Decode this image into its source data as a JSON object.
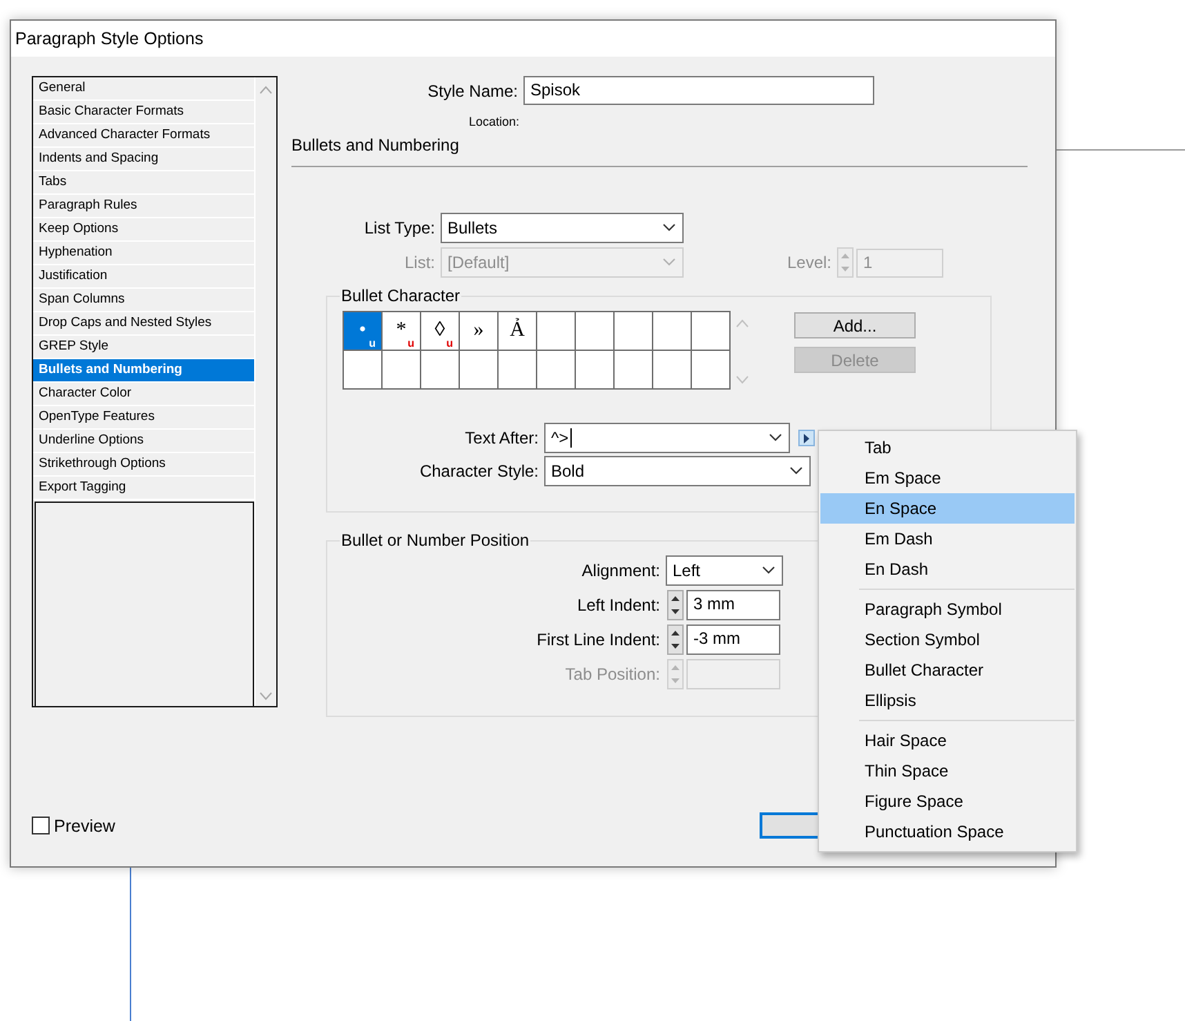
{
  "window": {
    "title": "Paragraph Style Options"
  },
  "sidebar": {
    "items": [
      {
        "label": "General",
        "selected": false
      },
      {
        "label": "Basic Character Formats",
        "selected": false
      },
      {
        "label": "Advanced Character Formats",
        "selected": false
      },
      {
        "label": "Indents and Spacing",
        "selected": false
      },
      {
        "label": "Tabs",
        "selected": false
      },
      {
        "label": "Paragraph Rules",
        "selected": false
      },
      {
        "label": "Keep Options",
        "selected": false
      },
      {
        "label": "Hyphenation",
        "selected": false
      },
      {
        "label": "Justification",
        "selected": false
      },
      {
        "label": "Span Columns",
        "selected": false
      },
      {
        "label": "Drop Caps and Nested Styles",
        "selected": false
      },
      {
        "label": "GREP Style",
        "selected": false
      },
      {
        "label": "Bullets and Numbering",
        "selected": true
      },
      {
        "label": "Character Color",
        "selected": false
      },
      {
        "label": "OpenType Features",
        "selected": false
      },
      {
        "label": "Underline Options",
        "selected": false
      },
      {
        "label": "Strikethrough Options",
        "selected": false
      },
      {
        "label": "Export Tagging",
        "selected": false
      }
    ]
  },
  "style_name": {
    "label": "Style Name:",
    "value": "Spisok"
  },
  "location": {
    "label": "Location:"
  },
  "section_title": "Bullets and Numbering",
  "list_type": {
    "label": "List Type:",
    "value": "Bullets",
    "disabled": false
  },
  "list": {
    "label": "List:",
    "value": "[Default]",
    "disabled": true
  },
  "level": {
    "label": "Level:",
    "value": "1",
    "disabled": true
  },
  "bullet_character": {
    "title": "Bullet Character",
    "cells": [
      {
        "char": "•",
        "marker": "u",
        "selected": true
      },
      {
        "char": "*",
        "marker": "u",
        "selected": false
      },
      {
        "char": "◊",
        "marker": "u",
        "selected": false
      },
      {
        "char": "»",
        "selected": false
      },
      {
        "char": "Ả",
        "selected": false
      }
    ],
    "buttons": [
      {
        "label": "Add...",
        "disabled": false
      },
      {
        "label": "Delete",
        "disabled": true
      }
    ],
    "text_after": {
      "label": "Text After:",
      "value": "^>"
    },
    "character_style": {
      "label": "Character Style:",
      "value": "Bold"
    }
  },
  "position": {
    "title": "Bullet or Number Position",
    "fields": [
      {
        "kind": "select",
        "label": "Alignment:",
        "value": "Left",
        "disabled": false
      },
      {
        "kind": "spinner",
        "label": "Left Indent:",
        "value": "3 mm",
        "disabled": false
      },
      {
        "kind": "spinner",
        "label": "First Line Indent:",
        "value": "-3 mm",
        "disabled": false
      },
      {
        "kind": "spinner",
        "label": "Tab Position:",
        "disabled": true
      }
    ]
  },
  "preview": {
    "label": "Preview",
    "checked": false
  },
  "text_after_menu": {
    "groups": [
      [
        {
          "label": "Tab",
          "selected": false
        },
        {
          "label": "Em Space",
          "selected": false
        },
        {
          "label": "En Space",
          "selected": true
        },
        {
          "label": "Em Dash",
          "selected": false
        },
        {
          "label": "En Dash",
          "selected": false
        }
      ],
      [
        {
          "label": "Paragraph Symbol",
          "selected": false
        },
        {
          "label": "Section Symbol",
          "selected": false
        },
        {
          "label": "Bullet Character",
          "selected": false
        },
        {
          "label": "Ellipsis",
          "selected": false
        }
      ],
      [
        {
          "label": "Hair Space",
          "selected": false
        },
        {
          "label": "Thin Space",
          "selected": false
        },
        {
          "label": "Figure Space",
          "selected": false
        },
        {
          "label": "Punctuation Space",
          "selected": false
        }
      ]
    ]
  }
}
